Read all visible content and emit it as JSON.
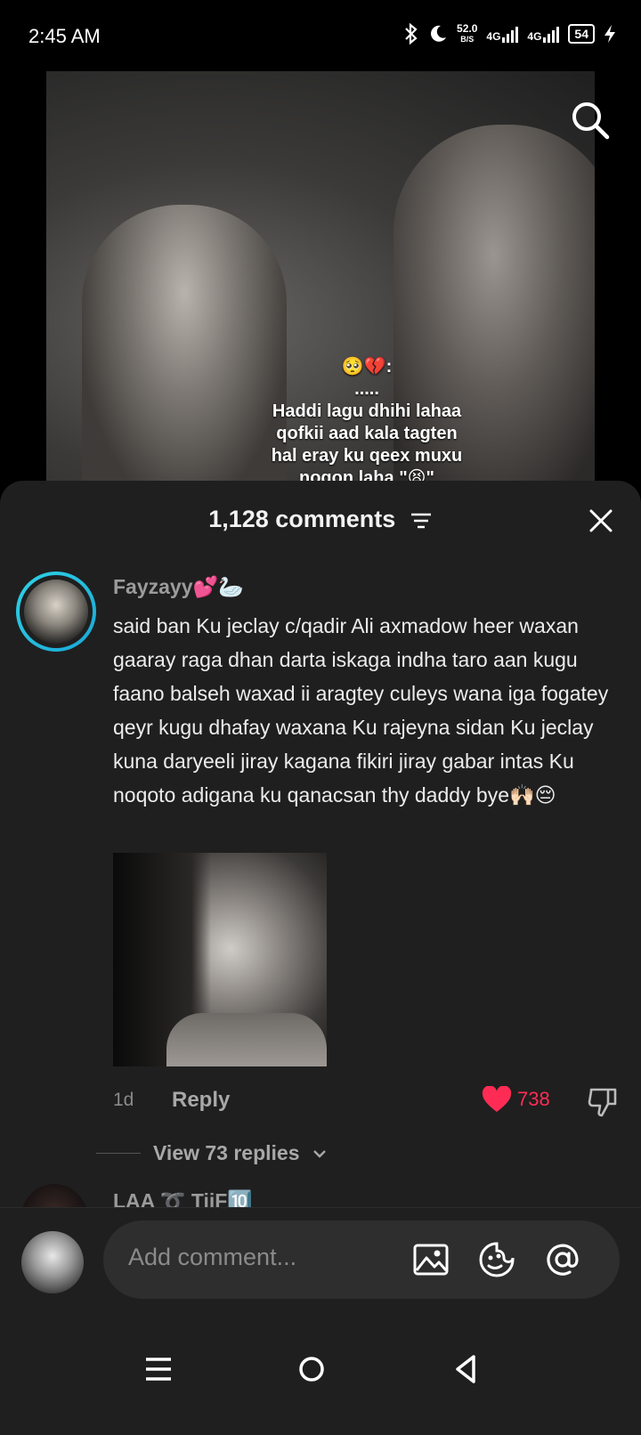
{
  "status_bar": {
    "time": "2:45 AM",
    "net_speed": "52.0",
    "net_unit": "B/S",
    "net1": "4G",
    "net2": "4G",
    "battery": "54"
  },
  "video": {
    "caption_lines": [
      "🥺💔:",
      ".....",
      "Haddi lagu dhihi lahaa",
      "qofkii aad kala tagten",
      "hal eray ku qeex muxu",
      "noqon laha \"😫\""
    ]
  },
  "comments_sheet": {
    "title": "1,128 comments",
    "comments": [
      {
        "username": "Fayzayy💕🦢",
        "text": "said ban Ku jeclay c/qadir Ali axmadow heer waxan gaaray raga dhan darta iskaga indha taro aan kugu faano balseh waxad ii aragtey culeys wana iga fogatey qeyr kugu dhafay waxana Ku rajeyna sidan Ku jeclay kuna daryeeli jiray kagana fikiri jiray gabar intas Ku noqoto adigana ku qanacsan thy daddy bye🙌🏻😔",
        "time": "1d",
        "reply_label": "Reply",
        "likes": "738",
        "view_replies": "View 73 replies"
      },
      {
        "username": "LAA ➰ TiiF🔟"
      }
    ]
  },
  "input": {
    "placeholder": "Add comment..."
  },
  "colors": {
    "accent": "#fe2c55",
    "sheet_bg": "#1f1f1f",
    "ring": "#2fd3e6"
  }
}
